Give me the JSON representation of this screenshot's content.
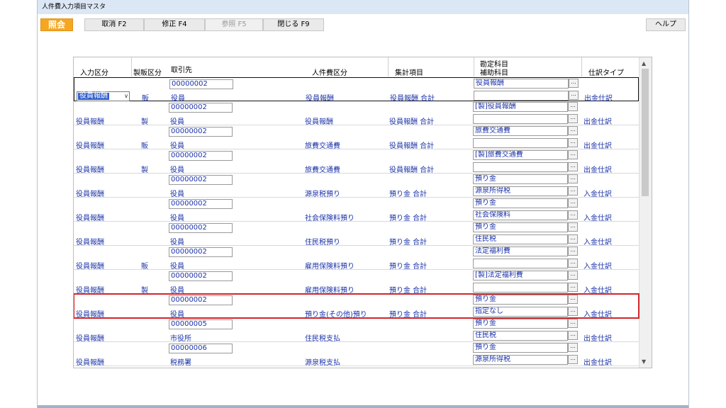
{
  "window": {
    "title": "人件費入力項目マスタ"
  },
  "toolbar": {
    "mode": "照会",
    "cancel": "取消 F2",
    "edit": "修正 F4",
    "reference": "参照 F5",
    "close": "閉じる F9",
    "help": "ヘルプ"
  },
  "grid": {
    "headers": {
      "input_category": "入力区分",
      "seihan_category": "製販区分",
      "partner": "取引先",
      "personnel_category": "人件費区分",
      "aggregation_item": "集計項目",
      "account_title": "勘定科目",
      "sub_account_title": "補助科目",
      "journal_type": "仕訳タイプ"
    },
    "selected_combo_value": "役員報酬",
    "rows": [
      {
        "input": "役員報酬",
        "seihan": "販",
        "code": "00000002",
        "partner": "役員",
        "personnel": "役員報酬",
        "aggregate": "役員報酬 合計",
        "account": "役員報酬",
        "sub": "",
        "journal": "出金仕訳"
      },
      {
        "input": "役員報酬",
        "seihan": "製",
        "code": "00000002",
        "partner": "役員",
        "personnel": "役員報酬",
        "aggregate": "役員報酬 合計",
        "account": "[製]役員報酬",
        "sub": "",
        "journal": "出金仕訳"
      },
      {
        "input": "役員報酬",
        "seihan": "販",
        "code": "00000002",
        "partner": "役員",
        "personnel": "旅費交通費",
        "aggregate": "役員報酬 合計",
        "account": "旅費交通費",
        "sub": "",
        "journal": "出金仕訳"
      },
      {
        "input": "役員報酬",
        "seihan": "製",
        "code": "00000002",
        "partner": "役員",
        "personnel": "旅費交通費",
        "aggregate": "役員報酬 合計",
        "account": "[製]旅費交通費",
        "sub": "",
        "journal": "出金仕訳"
      },
      {
        "input": "役員報酬",
        "seihan": "",
        "code": "00000002",
        "partner": "役員",
        "personnel": "源泉税預り",
        "aggregate": "預り金 合計",
        "account": "預り金",
        "sub": "源泉所得税",
        "journal": "入金仕訳"
      },
      {
        "input": "役員報酬",
        "seihan": "",
        "code": "00000002",
        "partner": "役員",
        "personnel": "社会保険料預り",
        "aggregate": "預り金 合計",
        "account": "預り金",
        "sub": "社会保険料",
        "journal": "入金仕訳"
      },
      {
        "input": "役員報酬",
        "seihan": "",
        "code": "00000002",
        "partner": "役員",
        "personnel": "住民税預り",
        "aggregate": "預り金 合計",
        "account": "預り金",
        "sub": "住民税",
        "journal": "入金仕訳"
      },
      {
        "input": "役員報酬",
        "seihan": "販",
        "code": "00000002",
        "partner": "役員",
        "personnel": "雇用保険料預り",
        "aggregate": "預り金 合計",
        "account": "法定福利費",
        "sub": "",
        "journal": "入金仕訳"
      },
      {
        "input": "役員報酬",
        "seihan": "製",
        "code": "00000002",
        "partner": "役員",
        "personnel": "雇用保険料預り",
        "aggregate": "預り金 合計",
        "account": "[製]法定福利費",
        "sub": "",
        "journal": "入金仕訳"
      },
      {
        "input": "役員報酬",
        "seihan": "",
        "code": "00000002",
        "partner": "役員",
        "personnel": "預り金(その他)預り",
        "aggregate": "預り金 合計",
        "account": "預り金",
        "sub": "指定なし",
        "journal": "入金仕訳"
      },
      {
        "input": "役員報酬",
        "seihan": "",
        "code": "00000005",
        "partner": "市役所",
        "personnel": "住民税支払",
        "aggregate": "",
        "account": "預り金",
        "sub": "住民税",
        "journal": "出金仕訳"
      },
      {
        "input": "役員報酬",
        "seihan": "",
        "code": "00000006",
        "partner": "税務署",
        "personnel": "源泉税支払",
        "aggregate": "",
        "account": "預り金",
        "sub": "源泉所得税",
        "journal": "出金仕訳"
      }
    ]
  },
  "colors": {
    "text_blue": "#1c34a8",
    "mode_orange": "#f5a623",
    "highlight_red": "#d0262b"
  }
}
